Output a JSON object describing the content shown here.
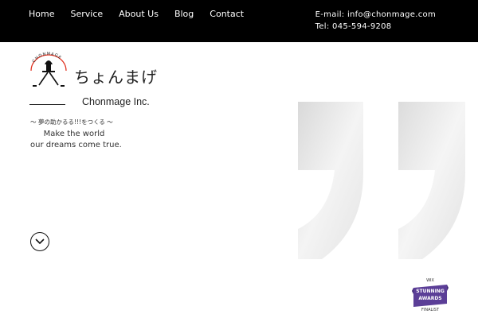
{
  "nav": {
    "items": [
      {
        "label": "Home"
      },
      {
        "label": "Service"
      },
      {
        "label": "About Us"
      },
      {
        "label": "Blog"
      },
      {
        "label": "Contact"
      }
    ]
  },
  "contact": {
    "email": "E-mail: info@chonmage.com",
    "tel": "Tel: 045-594-9208"
  },
  "logo": {
    "ring_text": "CHONMAGE",
    "japanese_name": "ちょんまげ"
  },
  "company_name": "Chonmage Inc.",
  "tagline": {
    "japanese": "～ 夢の助かるる!!!をつくる ～",
    "line1": "Make the world",
    "line2": "our dreams come true."
  },
  "badge": {
    "line1": "WIX",
    "line2": "STUNNING",
    "line3": "AWARDS",
    "line4": "FINALIST"
  },
  "colors": {
    "topbar": "#000000",
    "badge_purple": "#5b3e97",
    "accent_red": "#e0301e"
  },
  "icons": {
    "scroll": "chevron-down-icon",
    "logo": "chonmage-logo-icon"
  }
}
